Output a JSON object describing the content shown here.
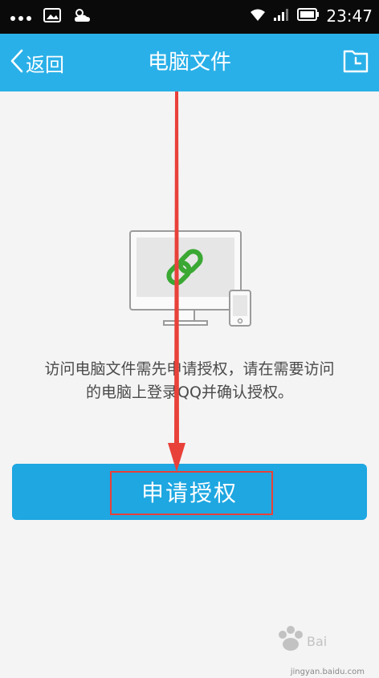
{
  "status_bar": {
    "time": "23:47",
    "icons": [
      "more-dots-icon",
      "image-icon",
      "weather-icon",
      "wifi-icon",
      "signal-icon",
      "battery-icon"
    ]
  },
  "header": {
    "back_label": "返回",
    "title": "电脑文件",
    "icons": [
      "chevron-left-icon",
      "history-icon"
    ]
  },
  "main": {
    "message_line1": "访问电脑文件需先申请授权，请在需要访问",
    "message_line2": "的电脑上登录QQ并确认授权。",
    "button_label": "申请授权"
  },
  "watermark": {
    "text": "jingyan.baidu.com"
  },
  "colors": {
    "header": "#2ab0e8",
    "button": "#1ea7e1",
    "annotation": "#e8413a",
    "link_green": "#3aa833"
  }
}
